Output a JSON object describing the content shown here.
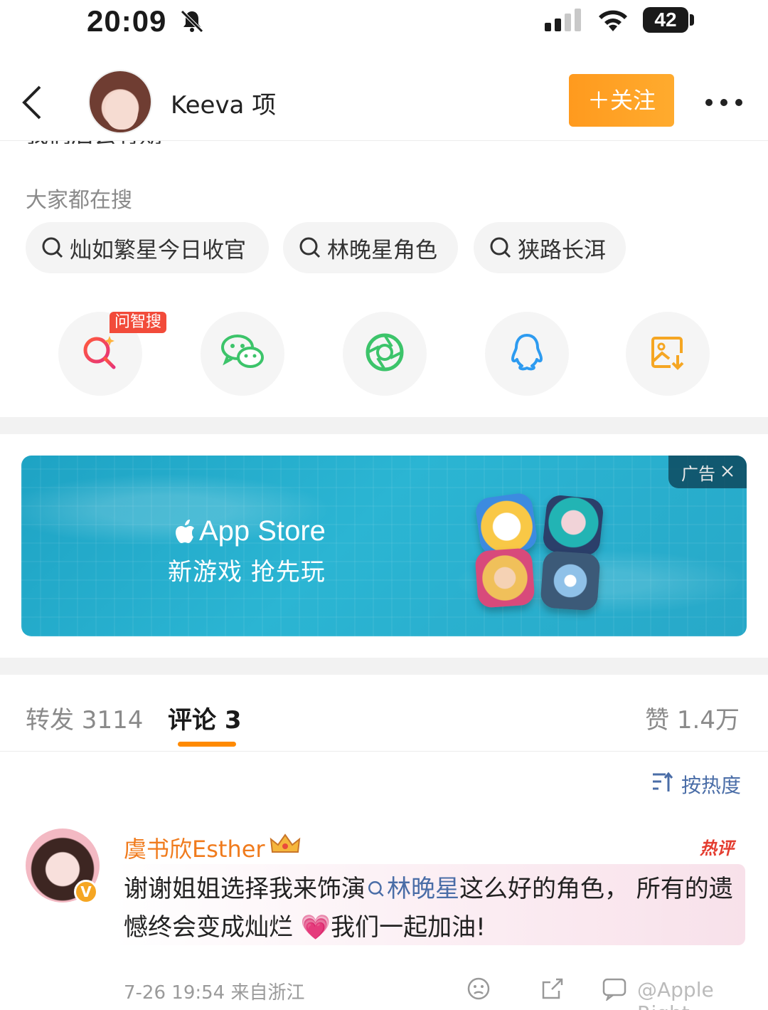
{
  "status_bar": {
    "time": "20:09",
    "battery": "42"
  },
  "header": {
    "user_name": "Keeva 项",
    "follow_label": "＋关注"
  },
  "cut_text": "我们后会有期",
  "hot_search": {
    "title": "大家都在搜",
    "chips": [
      {
        "label": "灿如繁星今日收官"
      },
      {
        "label": "林晚星角色"
      },
      {
        "label": "狭路长洱"
      }
    ]
  },
  "share": {
    "ask_badge": "问智搜",
    "items": [
      "ask-search",
      "wechat",
      "moments",
      "qq",
      "save-image"
    ]
  },
  "ad": {
    "brand": "App Store",
    "subtitle": "新游戏 抢先玩",
    "tag": "广告"
  },
  "tabs": {
    "repost": "转发 3114",
    "comment": "评论 3",
    "like": "赞 1.4万"
  },
  "sort_label": "按热度",
  "comment": {
    "name": "虞书欣Esther",
    "hot_badge": "热评",
    "text_before": "谢谢姐姐选择我来饰演",
    "link_text": "林晚星",
    "text_after": "这么好的角色， 所有的遗憾终会变成灿烂",
    "heart": "💗",
    "text_end": "我们一起加油!",
    "time": "7-26 19:54  来自浙江"
  },
  "watermark": "@Apple Right",
  "colors": {
    "accent": "#ff9a1e",
    "link": "#4a6da7",
    "name_orange": "#f07b1d",
    "hot_red": "#e43d30"
  }
}
